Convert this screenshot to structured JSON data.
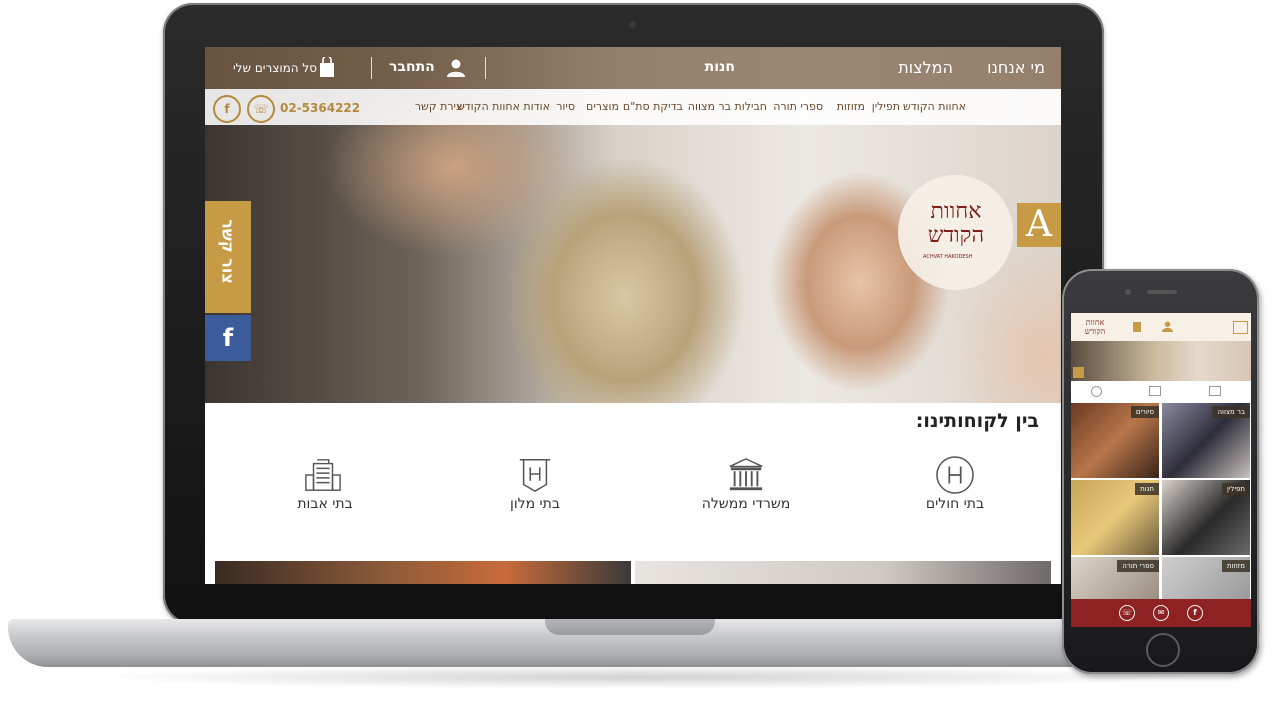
{
  "desktop": {
    "topbar": {
      "about": "מי אנחנו",
      "recommendations": "המלצות",
      "shop": "חנות",
      "login": "התחבר",
      "cart": "סל המוצרים שלי"
    },
    "nav": [
      "אחוות הקודש",
      "תפילין",
      "מזוזות",
      "ספרי תורה",
      "חבילות בר מצווה",
      "בדיקת סת\"ם",
      "מוצרים",
      "סיור",
      "אודות אחוות הקודש",
      "יצירת קשר"
    ],
    "phone": "02-5364222",
    "logo": {
      "line1": "אחוות",
      "line2": "הקודש",
      "sub": "ACHVAT HAKODESH",
      "letter": "A"
    },
    "side": {
      "contact": "צור קשר",
      "facebook": "f"
    },
    "clients_title": "בין לקוחותינו:",
    "clients": [
      {
        "label": "בתי חולים",
        "icon": "hospital-icon"
      },
      {
        "label": "משרדי ממשלה",
        "icon": "government-building-icon"
      },
      {
        "label": "בתי מלון",
        "icon": "hotel-icon"
      },
      {
        "label": "בתי אבות",
        "icon": "retirement-home-icon"
      }
    ]
  },
  "mobile": {
    "logo_line1": "אחוות",
    "logo_line2": "הקודש",
    "tiles": [
      "בר מצווה",
      "סיורים",
      "תפילין",
      "חנות",
      "מזוזות",
      "ספרי תורה"
    ],
    "footer": {
      "facebook": "f"
    }
  },
  "colors": {
    "gold": "#c79a45",
    "brown": "#6b4a2b",
    "burgundy": "#7d1f1a",
    "facebook": "#3b5b9a",
    "mobile_footer": "#8e2222"
  }
}
